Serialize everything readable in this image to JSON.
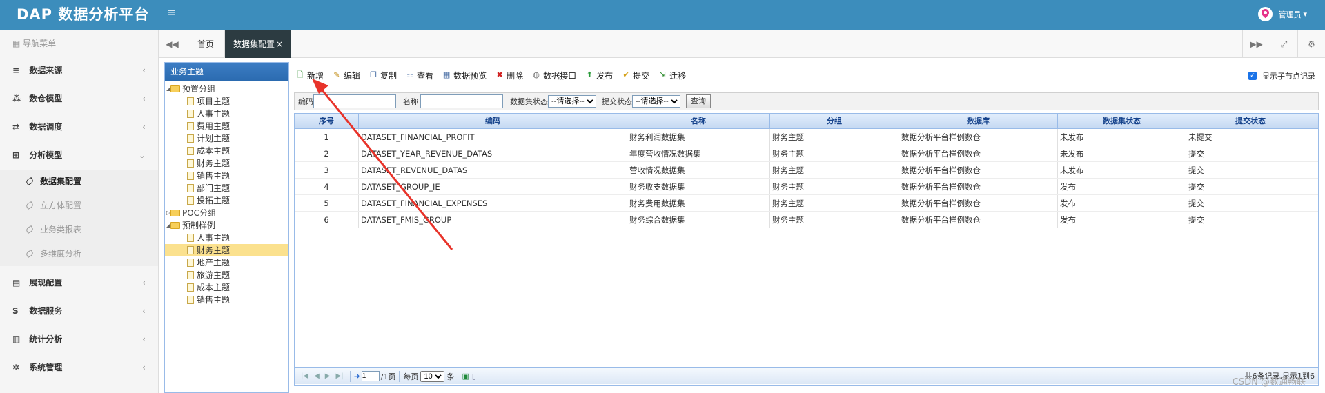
{
  "header": {
    "logo": "DAP 数据分析平台",
    "menu_toggle": "≡",
    "user": "管理员",
    "user_caret": "▾"
  },
  "sidebar": {
    "nav_title": "导航菜单",
    "menus_top": [
      {
        "label": "数据来源",
        "icon": "database-icon",
        "glyph": "≡"
      },
      {
        "label": "数仓模型",
        "icon": "cubes-icon",
        "glyph": "⁂"
      },
      {
        "label": "数据调度",
        "icon": "shuffle-icon",
        "glyph": "⇄"
      },
      {
        "label": "分析模型",
        "icon": "sitemap-icon",
        "glyph": "⊞",
        "expanded": true
      }
    ],
    "subitems": [
      {
        "label": "数据集配置",
        "active": true
      },
      {
        "label": "立方体配置"
      },
      {
        "label": "业务类报表"
      },
      {
        "label": "多维度分析"
      }
    ],
    "menus_bottom": [
      {
        "label": "展现配置",
        "icon": "film-icon",
        "glyph": "▤"
      },
      {
        "label": "数据服务",
        "icon": "dollar-icon",
        "glyph": "S"
      },
      {
        "label": "统计分析",
        "icon": "bar-chart-icon",
        "glyph": "▥"
      },
      {
        "label": "系统管理",
        "icon": "gear-icon",
        "glyph": "✲"
      }
    ]
  },
  "tabs": {
    "items": [
      {
        "label": "首页"
      },
      {
        "label": "数据集配置",
        "close": "×",
        "active": true
      }
    ]
  },
  "tree": {
    "title": "业务主题",
    "nodes": [
      {
        "label": "预置分组",
        "level": 0,
        "type": "folder",
        "toggle": "◢"
      },
      {
        "label": "项目主题",
        "level": 1,
        "type": "doc"
      },
      {
        "label": "人事主题",
        "level": 1,
        "type": "doc"
      },
      {
        "label": "费用主题",
        "level": 1,
        "type": "doc"
      },
      {
        "label": "计划主题",
        "level": 1,
        "type": "doc"
      },
      {
        "label": "成本主题",
        "level": 1,
        "type": "doc"
      },
      {
        "label": "财务主题",
        "level": 1,
        "type": "doc"
      },
      {
        "label": "销售主题",
        "level": 1,
        "type": "doc"
      },
      {
        "label": "部门主题",
        "level": 1,
        "type": "doc"
      },
      {
        "label": "投拓主题",
        "level": 1,
        "type": "doc"
      },
      {
        "label": "POC分组",
        "level": 0,
        "type": "folder",
        "toggle": "▷"
      },
      {
        "label": "预制样例",
        "level": 0,
        "type": "folder",
        "toggle": "◢"
      },
      {
        "label": "人事主题",
        "level": 1,
        "type": "doc"
      },
      {
        "label": "财务主题",
        "level": 1,
        "type": "doc",
        "selected": true
      },
      {
        "label": "地产主题",
        "level": 1,
        "type": "doc"
      },
      {
        "label": "旅游主题",
        "level": 1,
        "type": "doc"
      },
      {
        "label": "成本主题",
        "level": 1,
        "type": "doc"
      },
      {
        "label": "销售主题",
        "level": 1,
        "type": "doc"
      }
    ]
  },
  "toolbar": {
    "buttons": [
      {
        "label": "新增",
        "icon": "add-doc-icon",
        "glyph": "🗋",
        "color": "#2a8a2a"
      },
      {
        "label": "编辑",
        "icon": "pencil-icon",
        "glyph": "✎",
        "color": "#c08a10"
      },
      {
        "label": "复制",
        "icon": "copy-icon",
        "glyph": "❐",
        "color": "#4a6fa5"
      },
      {
        "label": "查看",
        "icon": "view-icon",
        "glyph": "☷",
        "color": "#4a6fa5"
      },
      {
        "label": "数据预览",
        "icon": "preview-icon",
        "glyph": "▦",
        "color": "#4a6fa5"
      },
      {
        "label": "删除",
        "icon": "delete-icon",
        "glyph": "✖",
        "color": "#d02020"
      },
      {
        "label": "数据接口",
        "icon": "interface-icon",
        "glyph": "◍",
        "color": "#666"
      },
      {
        "label": "发布",
        "icon": "publish-icon",
        "glyph": "⬆",
        "color": "#2a9a3a"
      },
      {
        "label": "提交",
        "icon": "submit-icon",
        "glyph": "✔",
        "color": "#d4a017"
      },
      {
        "label": "迁移",
        "icon": "migrate-icon",
        "glyph": "⇲",
        "color": "#2a8a2a"
      }
    ],
    "show_child_label": "显示子节点记录",
    "check": "✓"
  },
  "filter": {
    "code_label": "编码",
    "name_label": "名称",
    "dataset_status_label": "数据集状态",
    "dataset_status_value": "--请选择--",
    "submit_status_label": "提交状态",
    "submit_status_value": "--请选择--",
    "query_label": "查询"
  },
  "grid": {
    "columns": [
      "序号",
      "编码",
      "名称",
      "分组",
      "数据库",
      "数据集状态",
      "提交状态"
    ],
    "rows": [
      {
        "no": "1",
        "code": "DATASET_FINANCIAL_PROFIT",
        "name": "财务利润数据集",
        "group": "财务主题",
        "db": "数据分析平台样例数仓",
        "status": "未发布",
        "submit": "未提交"
      },
      {
        "no": "2",
        "code": "DATASET_YEAR_REVENUE_DATAS",
        "name": "年度营收情况数据集",
        "group": "财务主题",
        "db": "数据分析平台样例数仓",
        "status": "未发布",
        "submit": "提交"
      },
      {
        "no": "3",
        "code": "DATASET_REVENUE_DATAS",
        "name": "营收情况数据集",
        "group": "财务主题",
        "db": "数据分析平台样例数仓",
        "status": "未发布",
        "submit": "提交"
      },
      {
        "no": "4",
        "code": "DATASET_GROUP_IE",
        "name": "财务收支数据集",
        "group": "财务主题",
        "db": "数据分析平台样例数仓",
        "status": "发布",
        "submit": "提交"
      },
      {
        "no": "5",
        "code": "DATASET_FINANCIAL_EXPENSES",
        "name": "财务费用数据集",
        "group": "财务主题",
        "db": "数据分析平台样例数仓",
        "status": "发布",
        "submit": "提交"
      },
      {
        "no": "6",
        "code": "DATASET_FMIS_GROUP",
        "name": "财务综合数据集",
        "group": "财务主题",
        "db": "数据分析平台样例数仓",
        "status": "发布",
        "submit": "提交"
      }
    ]
  },
  "pager": {
    "page": "1",
    "total_pages": "/1页",
    "per_page_label": "每页",
    "per_page": "10",
    "unit": "条",
    "info": "共6条记录,显示1到6"
  },
  "watermark": "CSDN @数通畅联",
  "colors": {
    "header": "#3c8dbc",
    "annotation_arrow": "#e8332a",
    "selected": "#fbe18e"
  }
}
